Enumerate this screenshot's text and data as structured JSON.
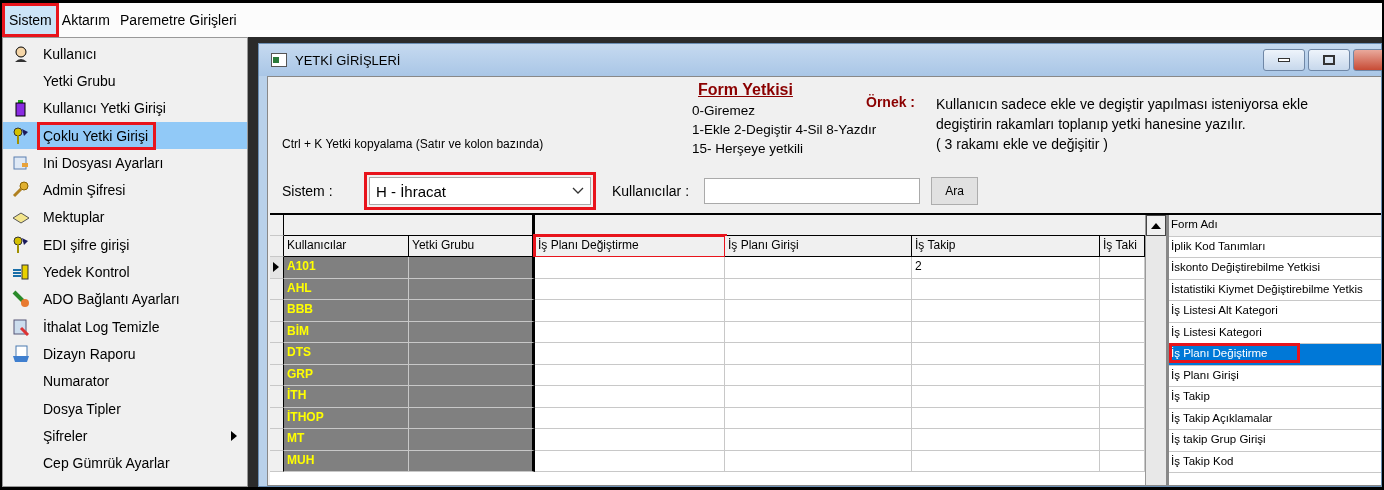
{
  "menubar": [
    {
      "label": "Sistem",
      "selected": true,
      "highlighted": true
    },
    {
      "label": "Aktarım",
      "selected": false,
      "highlighted": false
    },
    {
      "label": "Paremetre Girişleri",
      "selected": false,
      "highlighted": false
    }
  ],
  "menu": {
    "items": [
      {
        "label": "Kullanıcı",
        "selected": false,
        "highlighted": false,
        "submenu": false
      },
      {
        "label": "Yetki Grubu",
        "selected": false,
        "highlighted": false,
        "submenu": false
      },
      {
        "label": "Kullanıcı Yetki Girişi",
        "selected": false,
        "highlighted": false,
        "submenu": false
      },
      {
        "label": "Çoklu Yetki Girişi",
        "selected": true,
        "highlighted": true,
        "submenu": false
      },
      {
        "label": "Ini Dosyası  Ayarları",
        "selected": false,
        "highlighted": false,
        "submenu": false
      },
      {
        "label": "Admin Şifresi",
        "selected": false,
        "highlighted": false,
        "submenu": false
      },
      {
        "label": "Mektuplar",
        "selected": false,
        "highlighted": false,
        "submenu": false
      },
      {
        "label": "EDI şifre girişi",
        "selected": false,
        "highlighted": false,
        "submenu": false
      },
      {
        "label": "Yedek Kontrol",
        "selected": false,
        "highlighted": false,
        "submenu": false
      },
      {
        "label": "ADO Bağlantı Ayarları",
        "selected": false,
        "highlighted": false,
        "submenu": false
      },
      {
        "label": "İthalat Log Temizle",
        "selected": false,
        "highlighted": false,
        "submenu": false
      },
      {
        "label": "Dizayn Raporu",
        "selected": false,
        "highlighted": false,
        "submenu": false
      },
      {
        "label": "Numarator",
        "selected": false,
        "highlighted": false,
        "submenu": false
      },
      {
        "label": "Dosya Tipler",
        "selected": false,
        "highlighted": false,
        "submenu": false
      },
      {
        "label": "Şifreler",
        "selected": false,
        "highlighted": false,
        "submenu": true
      },
      {
        "label": "Cep Gümrük Ayarlar",
        "selected": false,
        "highlighted": false,
        "submenu": false
      }
    ]
  },
  "window": {
    "title": "YETKİ GİRİŞLERİ",
    "copy_hint": "Ctrl + K Yetki kopyalama (Satır ve kolon bazında)",
    "legend": {
      "title": "Form Yetkisi",
      "lines": [
        "0-Giremez",
        "1-Ekle  2-Degiştir  4-Sil  8-Yazdır",
        "15- Herşeye yetkili"
      ]
    },
    "example": {
      "label": "Örnek :",
      "lines": [
        "Kullanıcın sadece ekle ve degiştir yapılması isteniyorsa  ekle",
        "degiştirin rakamları toplanıp yetki hanesine yazılır.",
        "( 3 rakamı ekle ve değişitir )"
      ]
    },
    "sistem": {
      "label": "Sistem :",
      "value": "H - İhracat",
      "highlighted": true
    },
    "kullanicilar": {
      "label": "Kullanıcılar :"
    },
    "search_button": "Ara",
    "grid": {
      "frozen_columns": [
        "Kullanıcılar",
        "Yetki Grubu"
      ],
      "columns": [
        {
          "label": "İş Planı Değiştirme",
          "highlighted": true
        },
        {
          "label": "İş Planı Girişi",
          "highlighted": false
        },
        {
          "label": "İş Takip",
          "highlighted": false
        },
        {
          "label": "İş Taki",
          "highlighted": false
        }
      ],
      "rows": [
        {
          "user": "A101",
          "current": true,
          "cells": [
            null,
            null,
            "2",
            null
          ]
        },
        {
          "user": "AHL",
          "current": false
        },
        {
          "user": "BBB",
          "current": false
        },
        {
          "user": "BİM",
          "current": false
        },
        {
          "user": "DTS",
          "current": false
        },
        {
          "user": "GRP",
          "current": false
        },
        {
          "user": "İTH",
          "current": false
        },
        {
          "user": "İTHOP",
          "current": false
        },
        {
          "user": "MT",
          "current": false
        },
        {
          "user": "MUH",
          "current": false
        }
      ]
    },
    "forms": {
      "header": "Form Adı",
      "items": [
        {
          "label": "İplik Kod Tanımları",
          "selected": false,
          "highlighted": false
        },
        {
          "label": "İskonto Değiştirebilme Yetkisi",
          "selected": false,
          "highlighted": false
        },
        {
          "label": "İstatistiki Kiymet Değiştirebilme Yetkis",
          "selected": false,
          "highlighted": false
        },
        {
          "label": "İş Listesi Alt Kategori",
          "selected": false,
          "highlighted": false
        },
        {
          "label": "İş Listesi Kategori",
          "selected": false,
          "highlighted": false
        },
        {
          "label": "İş Planı Değiştirme",
          "selected": true,
          "highlighted": true
        },
        {
          "label": "İş Planı Girişi",
          "selected": false,
          "highlighted": false
        },
        {
          "label": "İş Takip",
          "selected": false,
          "highlighted": false
        },
        {
          "label": "İş Takip Açıklamalar",
          "selected": false,
          "highlighted": false
        },
        {
          "label": "İş takip Grup Girişi",
          "selected": false,
          "highlighted": false
        },
        {
          "label": "İş Takip Kod",
          "selected": false,
          "highlighted": false
        }
      ]
    }
  }
}
